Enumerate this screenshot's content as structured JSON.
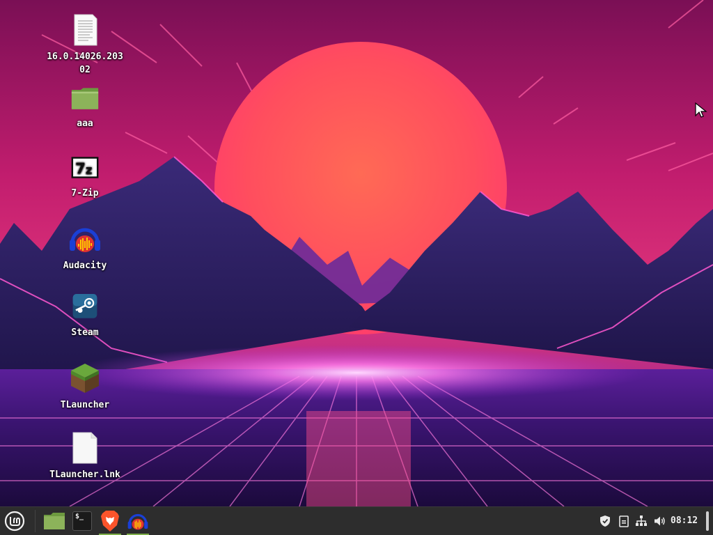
{
  "desktop": {
    "icons": [
      {
        "label": "16.0.14026.20302",
        "icon": "document-icon"
      },
      {
        "label": "aaa",
        "icon": "folder-icon"
      },
      {
        "label": "7-Zip",
        "icon": "7zip-icon"
      },
      {
        "label": "Audacity",
        "icon": "audacity-icon"
      },
      {
        "label": "Steam",
        "icon": "steam-icon"
      },
      {
        "label": "TLauncher",
        "icon": "tlauncher-icon"
      },
      {
        "label": "TLauncher.lnk",
        "icon": "file-icon"
      }
    ]
  },
  "taskbar": {
    "menu_icon": "linux-mint-menu-icon",
    "pinned": [
      {
        "name": "files",
        "icon": "folder-icon"
      },
      {
        "name": "terminal",
        "icon": "terminal-icon",
        "glyph": "$_"
      },
      {
        "name": "brave",
        "icon": "brave-browser-icon"
      },
      {
        "name": "audacity",
        "icon": "audacity-icon"
      }
    ],
    "tray": [
      "shield-icon",
      "clipboard-icon",
      "network-icon",
      "volume-icon"
    ],
    "clock": "08:12"
  },
  "colors": {
    "taskbar_bg": "#2d2d2d",
    "folder_green": "#8cb35a",
    "active_indicator": "#7fb04a"
  }
}
